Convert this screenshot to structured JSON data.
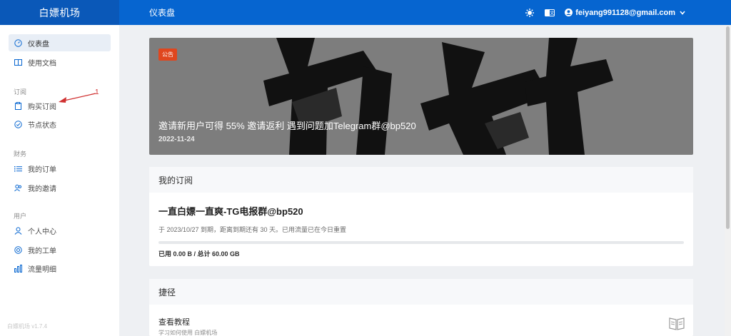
{
  "brand": "白嫖机场",
  "header": {
    "title": "仪表盘",
    "user_email": "feiyang991128@gmail.com"
  },
  "sidebar": {
    "items": [
      {
        "label": "仪表盘",
        "icon": "dashboard-icon"
      },
      {
        "label": "使用文档",
        "icon": "book-icon"
      },
      {
        "label": "购买订阅",
        "icon": "clipboard-icon"
      },
      {
        "label": "节点状态",
        "icon": "check-circle-icon"
      },
      {
        "label": "我的订单",
        "icon": "list-icon"
      },
      {
        "label": "我的邀请",
        "icon": "users-icon"
      },
      {
        "label": "个人中心",
        "icon": "user-icon"
      },
      {
        "label": "我的工单",
        "icon": "support-icon"
      },
      {
        "label": "流量明细",
        "icon": "bar-chart-icon"
      }
    ],
    "sections": {
      "subscribe": "订阅",
      "finance": "财务",
      "user": "用户"
    },
    "version": "白嫖机场 v1.7.4"
  },
  "annotation": {
    "number": "1"
  },
  "notice": {
    "badge": "公告",
    "text": "邀请新用户可得 55% 邀请返利 遇到问题加Telegram群@bp520",
    "date": "2022-11-24"
  },
  "subscription": {
    "header": "我的订阅",
    "plan": "一直白嫖一直爽-TG电报群@bp520",
    "info": "于 2023/10/27 到期，距离到期还有 30 天。已用流量已在今日重置",
    "usage": "已用 0.00 B / 总计 60.00 GB",
    "used_fraction": 0
  },
  "shortcuts": {
    "header": "捷径",
    "items": [
      {
        "title": "查看教程",
        "desc": "学习如何使用 白嫖机场"
      }
    ]
  },
  "colors": {
    "accent": "#0665d0",
    "badge": "#e0461e",
    "annotation": "#d03030"
  }
}
